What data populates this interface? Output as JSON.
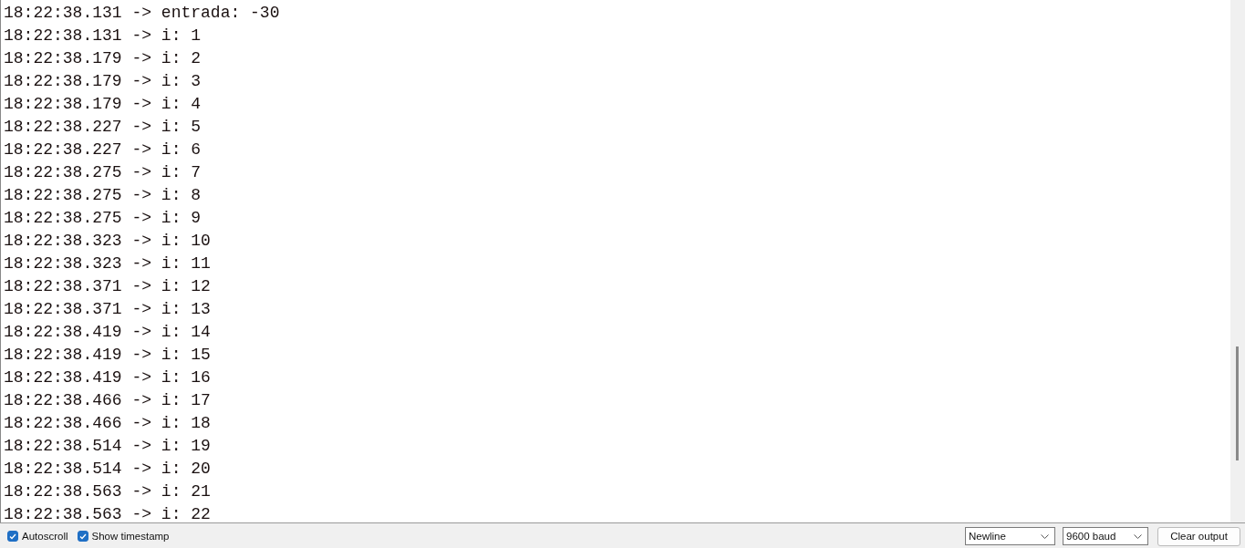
{
  "output_lines": [
    "18:22:38.131 -> entrada: -30",
    "18:22:38.131 -> i: 1",
    "18:22:38.179 -> i: 2",
    "18:22:38.179 -> i: 3",
    "18:22:38.179 -> i: 4",
    "18:22:38.227 -> i: 5",
    "18:22:38.227 -> i: 6",
    "18:22:38.275 -> i: 7",
    "18:22:38.275 -> i: 8",
    "18:22:38.275 -> i: 9",
    "18:22:38.323 -> i: 10",
    "18:22:38.323 -> i: 11",
    "18:22:38.371 -> i: 12",
    "18:22:38.371 -> i: 13",
    "18:22:38.419 -> i: 14",
    "18:22:38.419 -> i: 15",
    "18:22:38.419 -> i: 16",
    "18:22:38.466 -> i: 17",
    "18:22:38.466 -> i: 18",
    "18:22:38.514 -> i: 19",
    "18:22:38.514 -> i: 20",
    "18:22:38.563 -> i: 21",
    "18:22:38.563 -> i: 22"
  ],
  "options": [
    {
      "label": "Autoscroll",
      "checked": true
    },
    {
      "label": "Show timestamp",
      "checked": true
    }
  ],
  "line_ending": {
    "value": "Newline"
  },
  "baud_rate": {
    "value": "9600 baud"
  },
  "clear_button": {
    "label": "Clear output"
  }
}
